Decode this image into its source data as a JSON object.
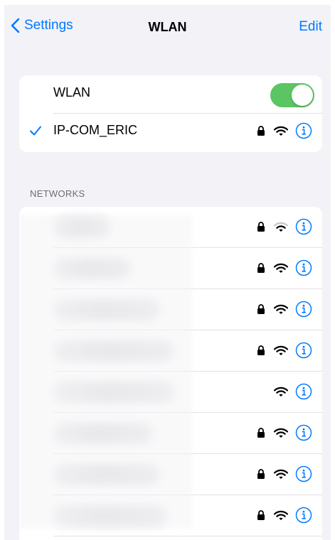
{
  "nav": {
    "back_label": "Settings",
    "title": "WLAN",
    "edit_label": "Edit"
  },
  "wlan": {
    "toggle_label": "WLAN",
    "toggle_on": true,
    "connected_network": "IP-COM_ERIC",
    "connected_secured": true
  },
  "networks_header": "NETWORKS",
  "networks": [
    {
      "name": "",
      "secured": true,
      "signal": "weak"
    },
    {
      "name": "",
      "secured": true,
      "signal": "full"
    },
    {
      "name": "",
      "secured": true,
      "signal": "full"
    },
    {
      "name": "",
      "secured": true,
      "signal": "full"
    },
    {
      "name": "",
      "secured": false,
      "signal": "full"
    },
    {
      "name": "",
      "secured": true,
      "signal": "full"
    },
    {
      "name": "",
      "secured": true,
      "signal": "full"
    },
    {
      "name": "",
      "secured": true,
      "signal": "full"
    }
  ],
  "icons": {
    "back": "chevron-left-icon",
    "check": "checkmark-icon",
    "lock": "lock-icon",
    "wifi": "wifi-icon",
    "info": "info-icon"
  },
  "colors": {
    "accent": "#007aff",
    "toggle_on": "#5ac562",
    "background": "#f2f2f7",
    "wifi_weak": "#c7c7cc"
  }
}
